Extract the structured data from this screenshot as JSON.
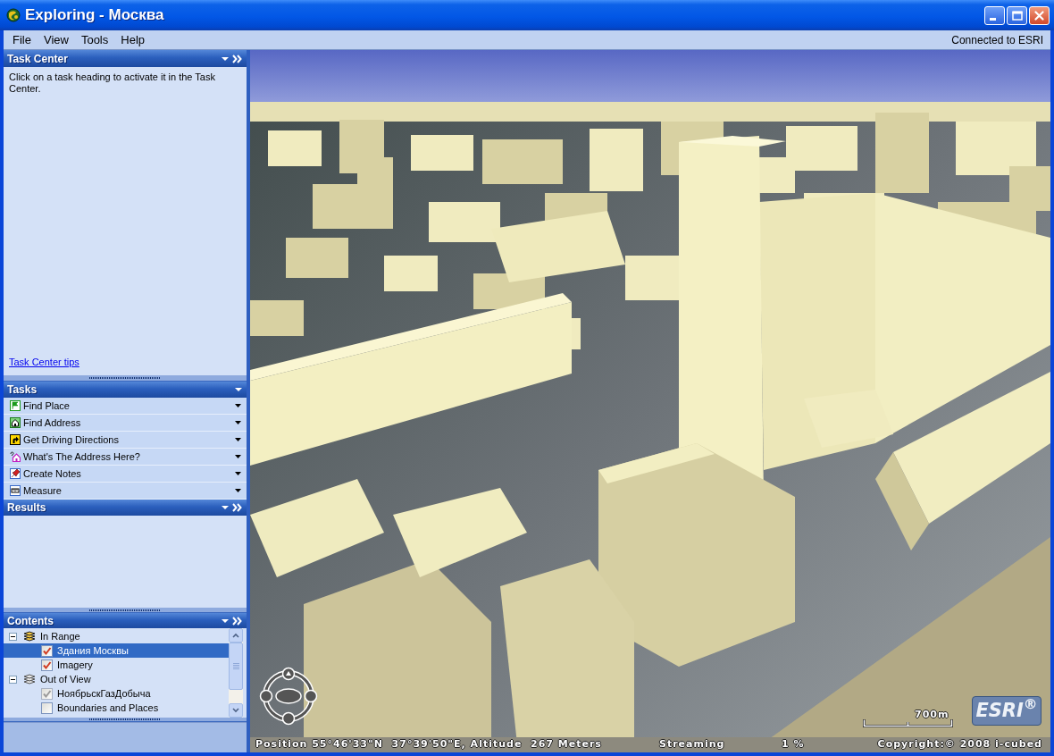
{
  "window": {
    "title": "Exploring - Москва"
  },
  "menu_bar": {
    "items": [
      "File",
      "View",
      "Tools",
      "Help"
    ],
    "connection_status": "Connected to ESRI"
  },
  "task_center": {
    "title": "Task Center",
    "expand_button": true,
    "description": "Click on a task heading to activate it in the Task Center.",
    "tips_link": "Task Center tips"
  },
  "tasks": {
    "title": "Tasks",
    "expand_button": false,
    "items": [
      {
        "label": "Find Place",
        "kind": "flag"
      },
      {
        "label": "Find Address",
        "kind": "house"
      },
      {
        "label": "Get Driving Directions",
        "kind": "directions"
      },
      {
        "label": "What's The Address Here?",
        "kind": "query"
      },
      {
        "label": "Create Notes",
        "kind": "note"
      },
      {
        "label": "Measure",
        "kind": "ruler"
      }
    ]
  },
  "results": {
    "title": "Results",
    "expand_button": true
  },
  "contents": {
    "title": "Contents",
    "expand_button": true,
    "tree": [
      {
        "label": "In Range",
        "expanded": true,
        "disabled": false,
        "selected": false,
        "children": [
          {
            "label": "Здания Москвы",
            "checked": true,
            "disabled": false,
            "selected": true
          },
          {
            "label": "Imagery",
            "checked": true,
            "disabled": false,
            "selected": false
          }
        ]
      },
      {
        "label": "Out of View",
        "expanded": true,
        "disabled": true,
        "selected": false,
        "children": [
          {
            "label": "НоябрьскГазДобыча",
            "checked": true,
            "disabled": true,
            "selected": false
          },
          {
            "label": "Boundaries and Places",
            "checked": false,
            "disabled": false,
            "selected": false
          }
        ]
      }
    ]
  },
  "map_view": {
    "scale_label": "700m",
    "logo": "ESRI$^{®}$",
    "status_bar": {
      "position": "Position 55°46'33\"N  37°39'50\"E, Altitude  267 Meters",
      "streaming": "Streaming",
      "progress": "1 %",
      "copyright": "Copyright:© 2008 i-cubed"
    }
  }
}
